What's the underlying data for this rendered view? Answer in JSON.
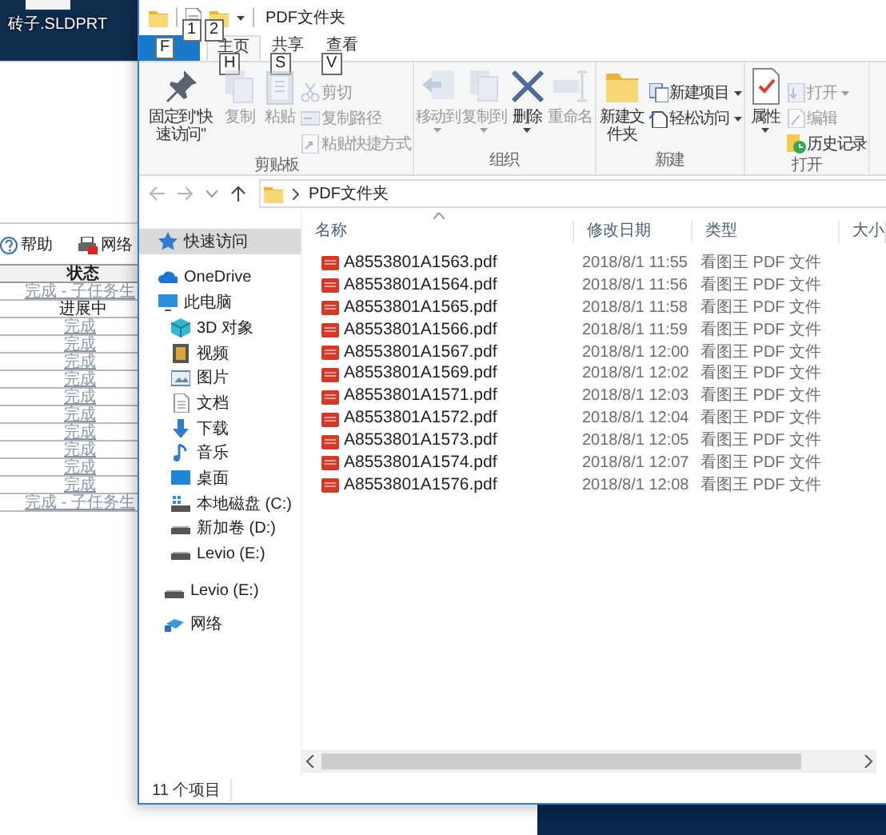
{
  "desktop": {
    "file_label": "砖子.SLDPRT"
  },
  "background_app": {
    "toolbar": [
      {
        "label": "帮助"
      },
      {
        "label": "网络"
      }
    ],
    "table": {
      "columns": [
        "状态"
      ],
      "rows": [
        {
          "status": "完成 - 子任务生",
          "link": true
        },
        {
          "status": "进展中",
          "link": false
        },
        {
          "status": "完成",
          "link": true
        },
        {
          "status": "完成",
          "link": true
        },
        {
          "status": "完成",
          "link": true
        },
        {
          "status": "完成",
          "link": true
        },
        {
          "status": "完成",
          "link": true
        },
        {
          "status": "完成",
          "link": true
        },
        {
          "status": "完成",
          "link": true
        },
        {
          "status": "完成",
          "link": true
        },
        {
          "status": "完成",
          "link": true
        },
        {
          "status": "完成",
          "link": true
        },
        {
          "status": "完成 - 子任务生",
          "link": true
        }
      ]
    }
  },
  "explorer": {
    "title": "PDF文件夹",
    "quick_access_key_tips": [
      "1",
      "2"
    ],
    "tabs": [
      {
        "kind": "file",
        "key_tip": "F",
        "selected": false
      },
      {
        "label": "主页",
        "kind": "tab",
        "key_tip": "H",
        "selected": true
      },
      {
        "label": "共享",
        "kind": "tab",
        "key_tip": "S",
        "selected": false
      },
      {
        "label": "查看",
        "kind": "tab",
        "key_tip": "V",
        "selected": false
      }
    ],
    "ribbon": {
      "groups": [
        {
          "label": "剪贴板",
          "buttons": [
            {
              "label": "固定到\"快速访问\"",
              "kind": "large",
              "disabled": false,
              "dropdown": false
            },
            {
              "label": "复制",
              "kind": "large",
              "disabled": true,
              "dropdown": false
            },
            {
              "label": "粘贴",
              "kind": "large",
              "disabled": true,
              "dropdown": false
            },
            {
              "label": "剪切",
              "kind": "small",
              "disabled": true,
              "dropdown": false
            },
            {
              "label": "复制路径",
              "kind": "small",
              "disabled": true,
              "dropdown": false
            },
            {
              "label": "粘贴快捷方式",
              "kind": "small",
              "disabled": true,
              "dropdown": false
            }
          ]
        },
        {
          "label": "组织",
          "buttons": [
            {
              "label": "移动到",
              "kind": "large",
              "disabled": true,
              "dropdown": true
            },
            {
              "label": "复制到",
              "kind": "large",
              "disabled": true,
              "dropdown": true
            },
            {
              "label": "删除",
              "kind": "large",
              "disabled": false,
              "dropdown": true
            },
            {
              "label": "重命名",
              "kind": "large",
              "disabled": true,
              "dropdown": false
            }
          ]
        },
        {
          "label": "新建",
          "buttons": [
            {
              "label": "新建文件夹",
              "kind": "large",
              "disabled": false,
              "dropdown": false
            },
            {
              "label": "新建项目",
              "kind": "small",
              "disabled": false,
              "dropdown": true
            },
            {
              "label": "轻松访问",
              "kind": "small",
              "disabled": false,
              "dropdown": true
            }
          ]
        },
        {
          "label": "打开",
          "buttons": [
            {
              "label": "属性",
              "kind": "large",
              "disabled": false,
              "dropdown": true
            },
            {
              "label": "打开",
              "kind": "small",
              "disabled": true,
              "dropdown": true
            },
            {
              "label": "编辑",
              "kind": "small",
              "disabled": true,
              "dropdown": false
            },
            {
              "label": "历史记录",
              "kind": "small",
              "disabled": false,
              "dropdown": false
            }
          ]
        }
      ]
    },
    "address": {
      "path": "PDF文件夹"
    },
    "nav": [
      {
        "label": "快速访问",
        "selected": true
      },
      {
        "label": "OneDrive",
        "selected": false
      },
      {
        "label": "此电脑",
        "selected": false,
        "children": [
          {
            "label": "3D 对象",
            "selected": false
          },
          {
            "label": "视频",
            "selected": false
          },
          {
            "label": "图片",
            "selected": false
          },
          {
            "label": "文档",
            "selected": false
          },
          {
            "label": "下载",
            "selected": false
          },
          {
            "label": "音乐",
            "selected": false
          },
          {
            "label": "桌面",
            "selected": false
          },
          {
            "label": "本地磁盘 (C:)",
            "selected": false
          },
          {
            "label": "新加卷 (D:)",
            "selected": false
          },
          {
            "label": "Levio (E:)",
            "selected": false
          }
        ]
      },
      {
        "label": "Levio (E:)",
        "selected": false
      },
      {
        "label": "网络",
        "selected": false
      }
    ],
    "columns": [
      {
        "label": "名称",
        "sorted": true
      },
      {
        "label": "修改日期",
        "sorted": false
      },
      {
        "label": "类型",
        "sorted": false
      },
      {
        "label": "大小",
        "sorted": false
      }
    ],
    "files": [
      {
        "name": "A8553801A1563.pdf",
        "modified": "2018/8/1 11:55",
        "type": "看图王 PDF 文件"
      },
      {
        "name": "A8553801A1564.pdf",
        "modified": "2018/8/1 11:56",
        "type": "看图王 PDF 文件"
      },
      {
        "name": "A8553801A1565.pdf",
        "modified": "2018/8/1 11:58",
        "type": "看图王 PDF 文件"
      },
      {
        "name": "A8553801A1566.pdf",
        "modified": "2018/8/1 11:59",
        "type": "看图王 PDF 文件"
      },
      {
        "name": "A8553801A1567.pdf",
        "modified": "2018/8/1 12:00",
        "type": "看图王 PDF 文件"
      },
      {
        "name": "A8553801A1569.pdf",
        "modified": "2018/8/1 12:02",
        "type": "看图王 PDF 文件"
      },
      {
        "name": "A8553801A1571.pdf",
        "modified": "2018/8/1 12:03",
        "type": "看图王 PDF 文件"
      },
      {
        "name": "A8553801A1572.pdf",
        "modified": "2018/8/1 12:04",
        "type": "看图王 PDF 文件"
      },
      {
        "name": "A8553801A1573.pdf",
        "modified": "2018/8/1 12:05",
        "type": "看图王 PDF 文件"
      },
      {
        "name": "A8553801A1574.pdf",
        "modified": "2018/8/1 12:07",
        "type": "看图王 PDF 文件"
      },
      {
        "name": "A8553801A1576.pdf",
        "modified": "2018/8/1 12:08",
        "type": "看图王 PDF 文件"
      }
    ],
    "status_bar": "11 个项目"
  }
}
